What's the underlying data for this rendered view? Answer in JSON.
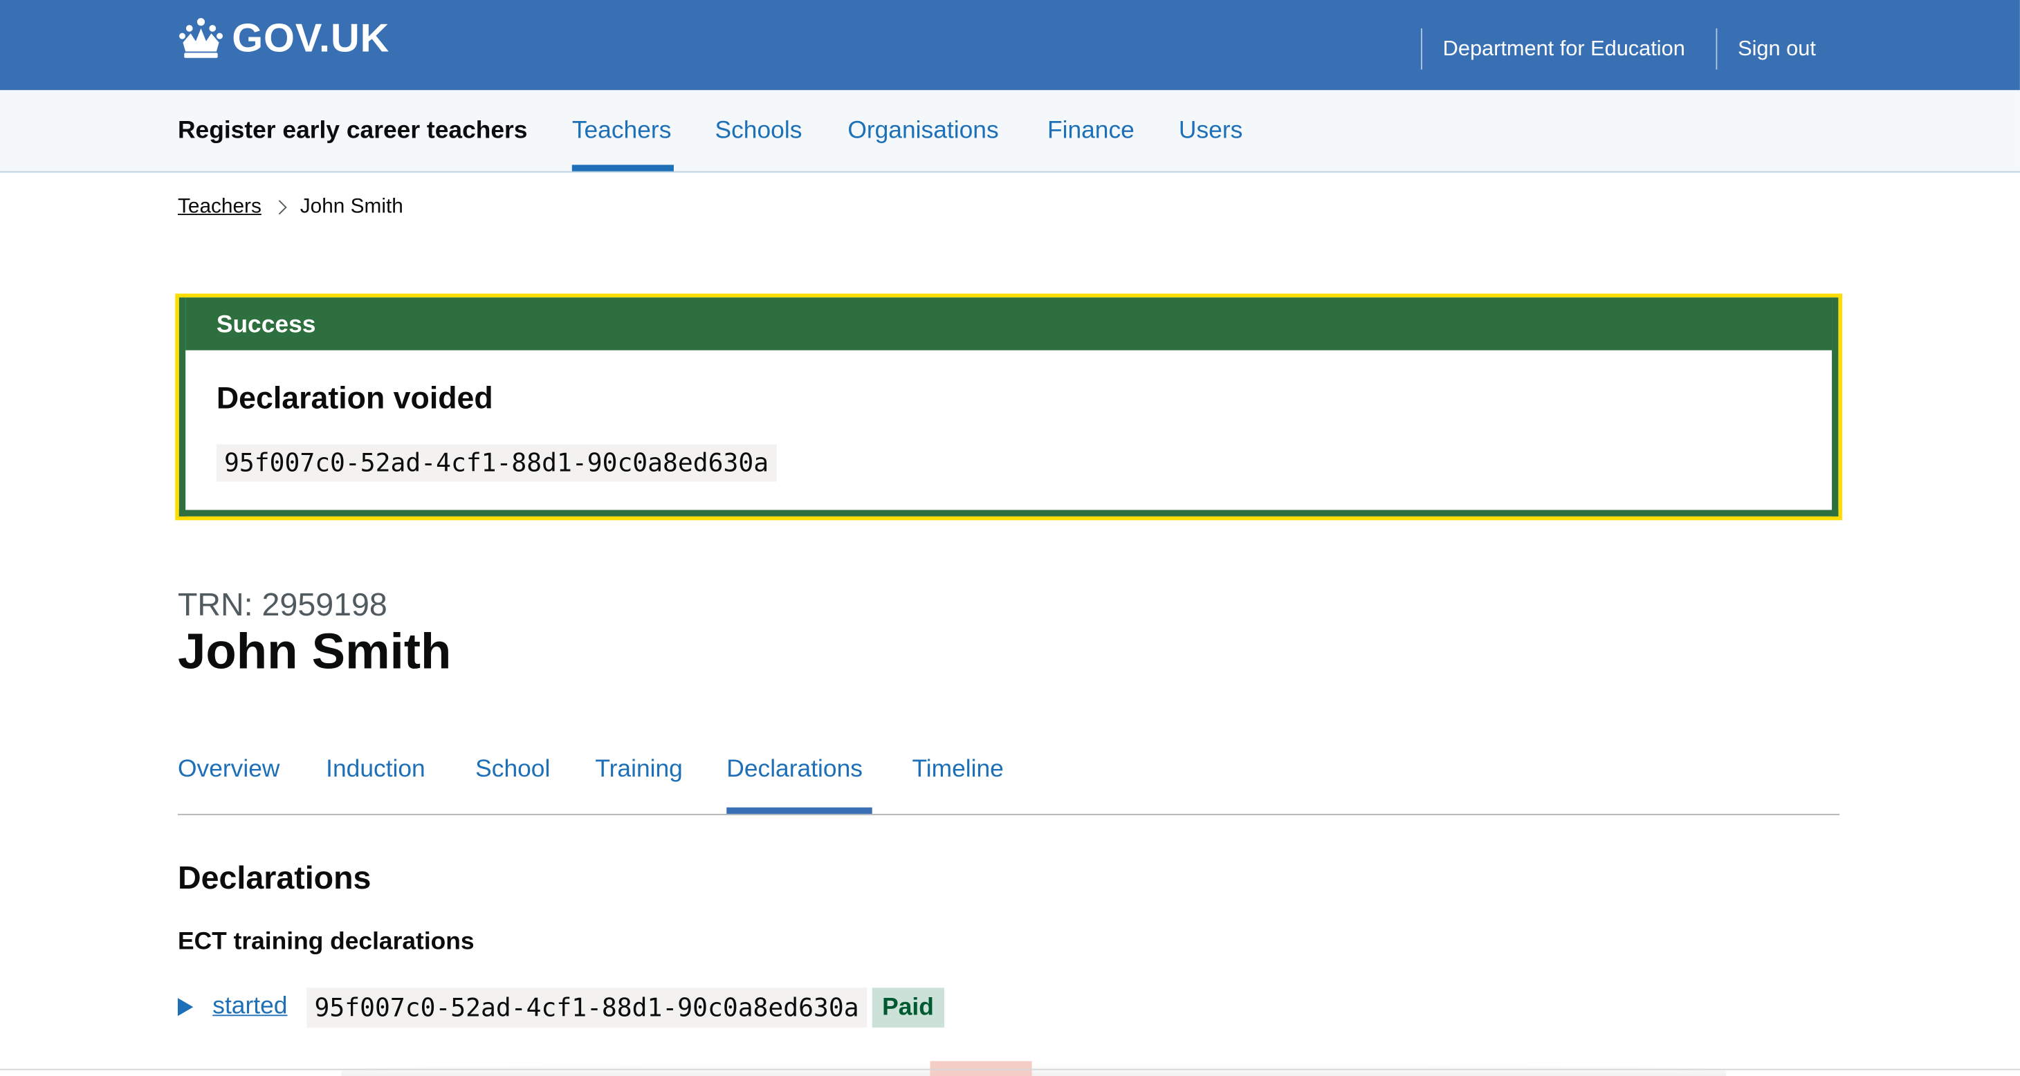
{
  "header": {
    "logo_text": "GOV.UK",
    "links": [
      "Department for Education",
      "Sign out"
    ]
  },
  "service_nav": {
    "service_name": "Register early career teachers",
    "items": [
      "Teachers",
      "Schools",
      "Organisations",
      "Finance",
      "Users"
    ],
    "active": "Teachers"
  },
  "breadcrumb": {
    "parent": "Teachers",
    "current": "John Smith"
  },
  "banner": {
    "title": "Success",
    "heading": "Declaration voided",
    "code": "95f007c0-52ad-4cf1-88d1-90c0a8ed630a"
  },
  "teacher": {
    "caption": "TRN: 2959198",
    "name": "John Smith"
  },
  "tabs": {
    "items": [
      "Overview",
      "Induction",
      "School",
      "Training",
      "Declarations",
      "Timeline"
    ],
    "active": "Declarations"
  },
  "declarations": {
    "heading": "Declarations",
    "subheading": "ECT training declarations",
    "entries": [
      {
        "type": "started",
        "id": "95f007c0-52ad-4cf1-88d1-90c0a8ed630a",
        "status": "Paid"
      }
    ]
  },
  "colors": {
    "header_blue": "#3870b3",
    "link_blue": "#1d70b8",
    "success_green": "#2e6f3f",
    "focus_yellow": "#ffdd00",
    "paid_tag_bg": "#cce2d8",
    "paid_tag_text": "#005a30"
  }
}
